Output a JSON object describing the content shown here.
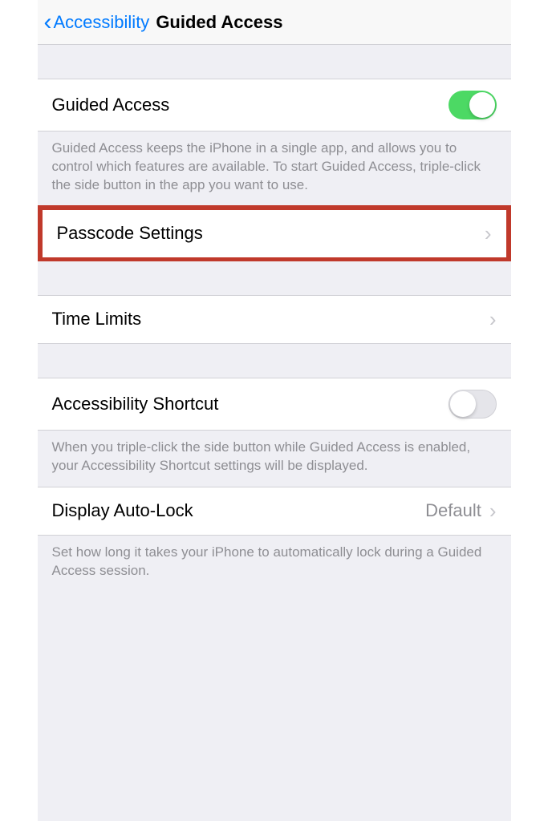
{
  "header": {
    "back_label": "Accessibility",
    "title": "Guided Access"
  },
  "rows": {
    "guided_access": {
      "label": "Guided Access",
      "footer": "Guided Access keeps the iPhone in a single app, and allows you to control which features are available. To start Guided Access, triple-click the side button in the app you want to use."
    },
    "passcode_settings": {
      "label": "Passcode Settings"
    },
    "time_limits": {
      "label": "Time Limits"
    },
    "accessibility_shortcut": {
      "label": "Accessibility Shortcut",
      "footer": "When you triple-click the side button while Guided Access is enabled, your Accessibility Shortcut settings will be displayed."
    },
    "display_auto_lock": {
      "label": "Display Auto-Lock",
      "value": "Default",
      "footer": "Set how long it takes your iPhone to automatically lock during a Guided Access session."
    }
  }
}
